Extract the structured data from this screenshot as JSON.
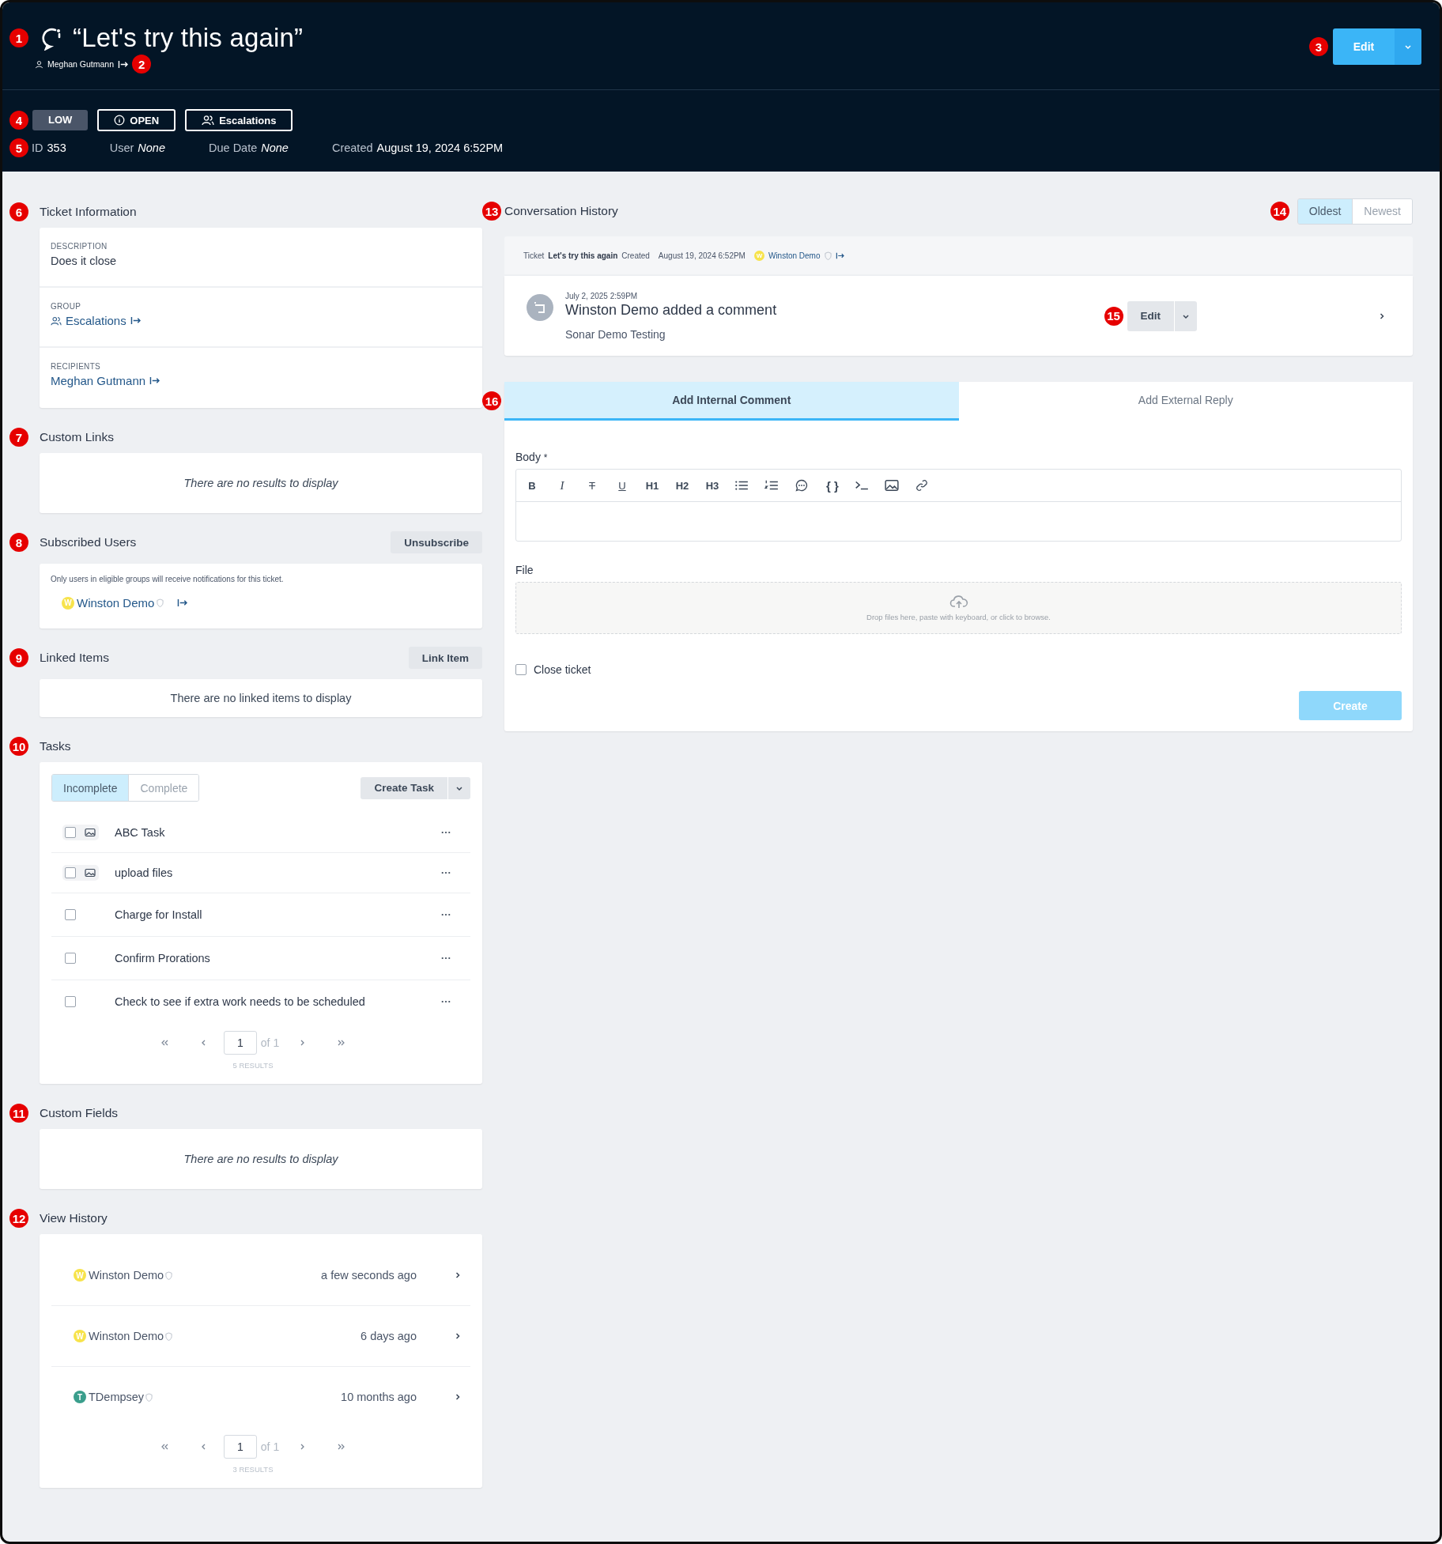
{
  "header": {
    "callout": "1",
    "title": "“Let's try this again”",
    "author": "Meghan Gutmann",
    "author_callout": "2",
    "edit_callout": "3",
    "edit_button": "Edit",
    "badges_callout": "4",
    "priority": "LOW",
    "status": "OPEN",
    "group": "Escalations",
    "meta_callout": "5",
    "meta": [
      {
        "label": "ID",
        "value": "353",
        "italic": false
      },
      {
        "label": "User",
        "value": "None",
        "italic": true
      },
      {
        "label": "Due Date",
        "value": "None",
        "italic": true
      },
      {
        "label": "Created",
        "value": "August 19, 2024 6:52PM",
        "italic": false
      }
    ]
  },
  "ticket_information": {
    "callout": "6",
    "title": "Ticket Information",
    "fields": [
      {
        "kind": "text",
        "label": "DESCRIPTION",
        "value": "Does it close"
      },
      {
        "kind": "group",
        "label": "GROUP",
        "value": "Escalations"
      },
      {
        "kind": "user",
        "label": "RECIPIENTS",
        "value": "Meghan Gutmann"
      }
    ]
  },
  "custom_links": {
    "callout": "7",
    "title": "Custom Links",
    "empty_text": "There are no results to display"
  },
  "subscribed_users": {
    "callout": "8",
    "title": "Subscribed Users",
    "button": "Unsubscribe",
    "note": "Only users in eligible groups will receive notifications for this ticket.",
    "users": [
      {
        "name": "Winston Demo",
        "initial": "W",
        "color": "#f7e34b"
      }
    ]
  },
  "linked_items": {
    "callout": "9",
    "title": "Linked Items",
    "button": "Link Item",
    "empty_text": "There are no linked items to display"
  },
  "tasks": {
    "callout": "10",
    "title": "Tasks",
    "filters": [
      {
        "label": "Incomplete",
        "selected": true
      },
      {
        "label": "Complete",
        "selected": false
      }
    ],
    "create_button": "Create Task",
    "items": [
      {
        "name": "ABC Task",
        "attachment": true,
        "checked": false
      },
      {
        "name": "upload files",
        "attachment": true,
        "checked": false
      },
      {
        "name": "Charge for Install",
        "attachment": false,
        "checked": false
      },
      {
        "name": "Confirm Prorations",
        "attachment": false,
        "checked": false
      },
      {
        "name": "Check to see if extra work needs to be scheduled",
        "attachment": false,
        "checked": false
      }
    ],
    "pagination": {
      "page": "1",
      "of": "of 1",
      "results": "5 RESULTS"
    }
  },
  "custom_fields": {
    "callout": "11",
    "title": "Custom Fields",
    "empty_text": "There are no results to display"
  },
  "view_history": {
    "callout": "12",
    "title": "View History",
    "items": [
      {
        "name": "Winston Demo",
        "initial": "W",
        "color": "#f7e34b",
        "time": "a few seconds ago"
      },
      {
        "name": "Winston Demo",
        "initial": "W",
        "color": "#f7e34b",
        "time": "6 days ago"
      },
      {
        "name": "TDempsey",
        "initial": "T",
        "color": "#3a9e8c",
        "time": "10 months ago"
      }
    ],
    "pagination": {
      "page": "1",
      "of": "of 1",
      "results": "3 RESULTS"
    }
  },
  "conversation": {
    "callout": "13",
    "title": "Conversation History",
    "sort_callout": "14",
    "sort": [
      {
        "label": "Oldest",
        "selected": true
      },
      {
        "label": "Newest",
        "selected": false
      }
    ],
    "created": {
      "prefix": "Ticket",
      "ticket": "Let's try this again",
      "verb": "Created",
      "date": "August 19, 2024 6:52PM",
      "user": "Winston Demo",
      "initial": "W",
      "color": "#f7e34b"
    },
    "comment": {
      "date": "July 2, 2025 2:59PM",
      "title": "Winston Demo added a comment",
      "body": "Sonar Demo Testing",
      "edit_callout": "15",
      "edit_button": "Edit"
    },
    "composer": {
      "callout": "16",
      "tabs": [
        {
          "label": "Add Internal Comment",
          "selected": true
        },
        {
          "label": "Add External Reply",
          "selected": false
        }
      ],
      "body_label": "Body",
      "required": "*",
      "toolbar": [
        {
          "kind": "bold",
          "label": "B"
        },
        {
          "kind": "italic",
          "label": "I"
        },
        {
          "kind": "strike",
          "label": "T"
        },
        {
          "kind": "underline",
          "label": "U"
        },
        {
          "kind": "heading",
          "label": "H1"
        },
        {
          "kind": "heading",
          "label": "H2"
        },
        {
          "kind": "heading",
          "label": "H3"
        },
        {
          "kind": "bullets"
        },
        {
          "kind": "numbers"
        },
        {
          "kind": "quote"
        },
        {
          "kind": "code",
          "label": "{ }"
        },
        {
          "kind": "terminal"
        },
        {
          "kind": "image"
        },
        {
          "kind": "link"
        }
      ],
      "file_label": "File",
      "drop_text": "Drop files here, paste with keyboard, or click to browse.",
      "close_ticket": {
        "label": "Close ticket",
        "checked": false
      },
      "create_button": "Create",
      "create_disabled": true
    }
  }
}
